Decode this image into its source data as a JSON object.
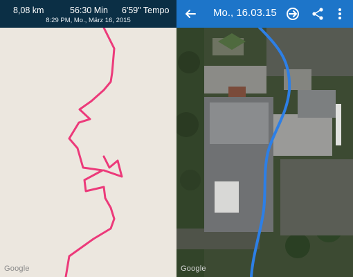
{
  "left": {
    "stats": {
      "distance": "8,08 km",
      "duration": "56:30 Min",
      "pace": "6'59\" Tempo"
    },
    "date_line": "8:29 PM, Mo., März 16, 2015",
    "attribution": "Google",
    "route_color": "#ec3a7a",
    "map_bg": "#ece7df",
    "header_color": "#0b2f45"
  },
  "right": {
    "title": "Mo., 16.03.15",
    "icons": [
      "back-arrow-icon",
      "cycle-icon",
      "share-icon",
      "more-vert-icon"
    ],
    "attribution": "Google",
    "route_color": "#2d7fe6",
    "appbar_color": "#1d75c9"
  }
}
